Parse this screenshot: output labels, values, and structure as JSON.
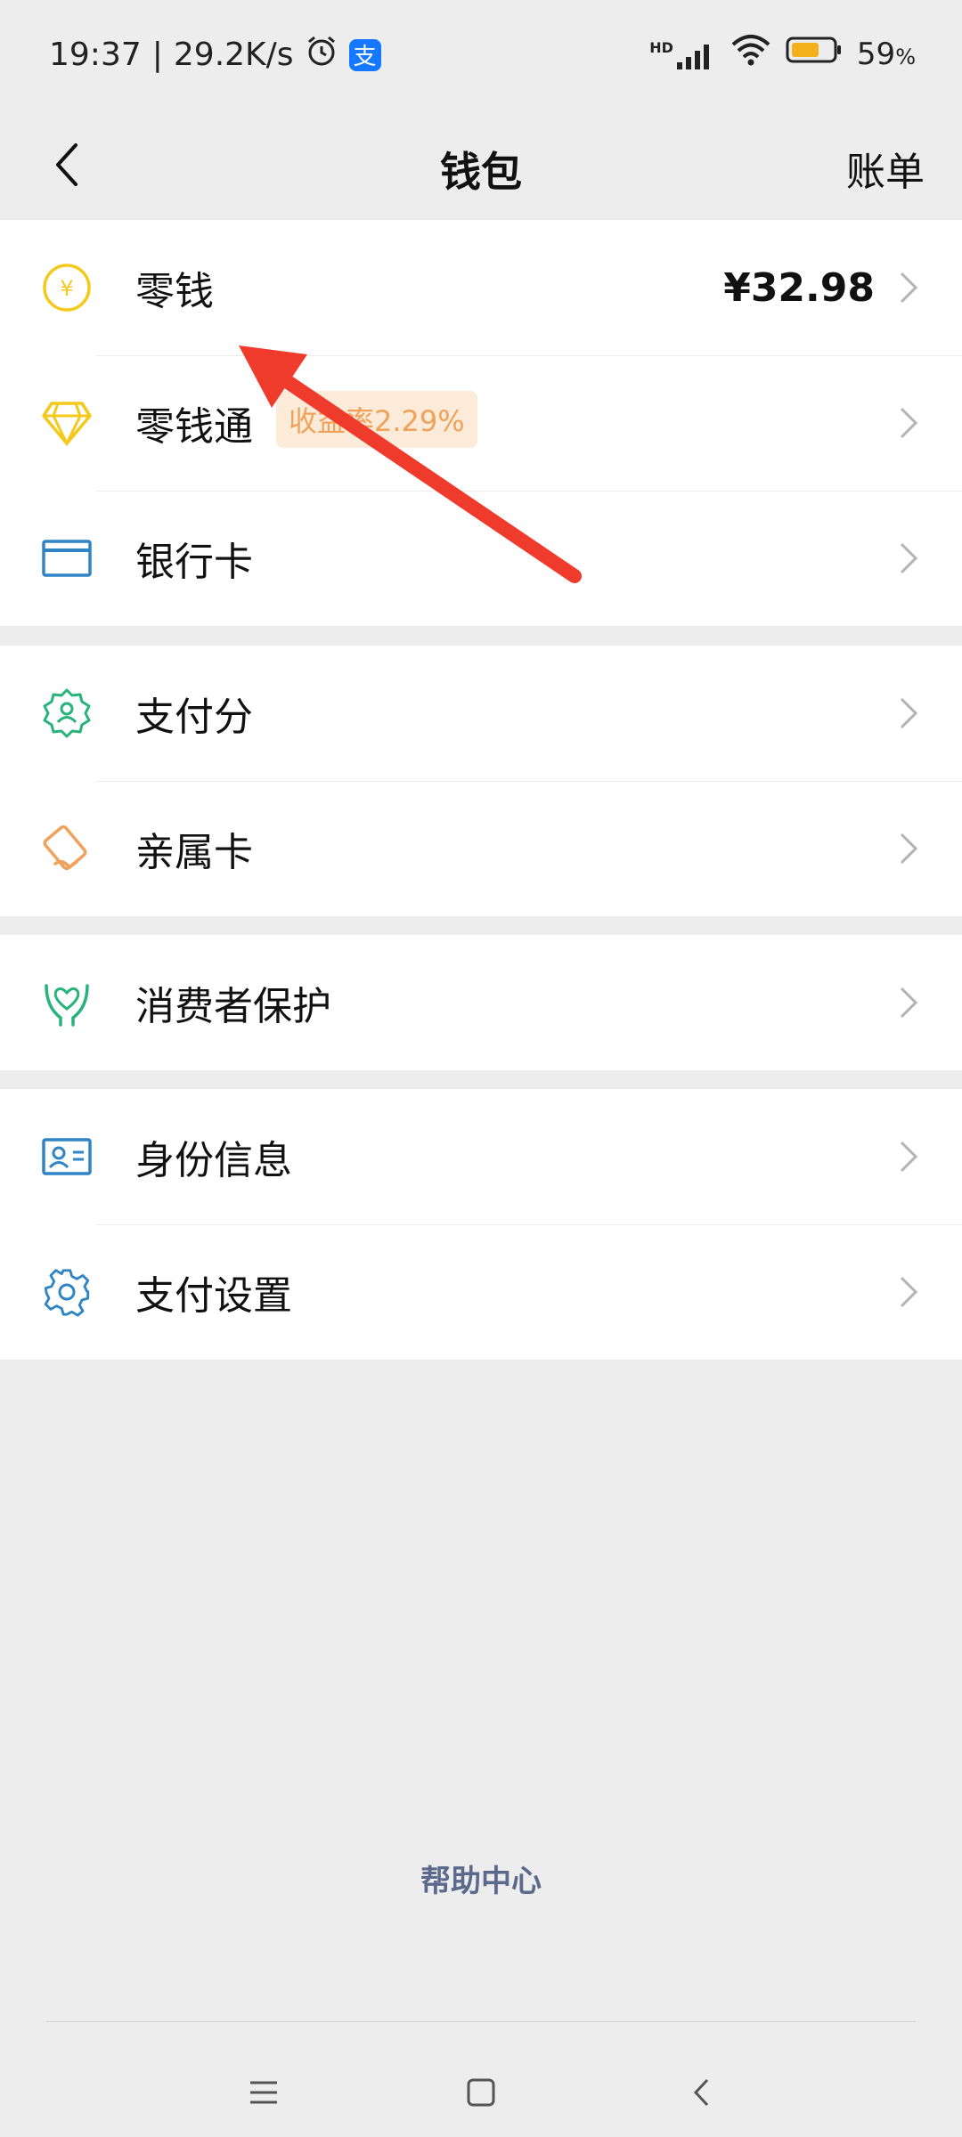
{
  "status_bar": {
    "time": "19:37",
    "speed": "29.2K/s",
    "alarm_icon": "alarm-clock-icon",
    "alipay_badge_label": "支",
    "network_label": "HD",
    "battery_percent": "59",
    "battery_unit": "%"
  },
  "header": {
    "title": "钱包",
    "right_action": "账单",
    "back_icon": "back-chevron-icon"
  },
  "groups": [
    {
      "items": [
        {
          "label": "零钱",
          "value": "¥32.98",
          "icon": "yuan-coin-icon"
        },
        {
          "label": "零钱通",
          "badge": "收益率2.29%",
          "icon": "diamond-icon"
        },
        {
          "label": "银行卡",
          "icon": "bank-card-icon"
        }
      ]
    },
    {
      "items": [
        {
          "label": "支付分",
          "icon": "pay-score-badge-icon"
        },
        {
          "label": "亲属卡",
          "icon": "family-card-icon"
        }
      ]
    },
    {
      "items": [
        {
          "label": "消费者保护",
          "icon": "hands-protect-icon"
        }
      ]
    },
    {
      "items": [
        {
          "label": "身份信息",
          "icon": "id-card-icon"
        },
        {
          "label": "支付设置",
          "icon": "gear-icon"
        }
      ]
    }
  ],
  "footer": {
    "help_link": "帮助中心"
  },
  "colors": {
    "accent_yellow": "#f3c91c",
    "bank_blue": "#2f84c5",
    "green": "#27b37b",
    "orange": "#f0a25a",
    "annotation_red": "#ee3b2b"
  }
}
